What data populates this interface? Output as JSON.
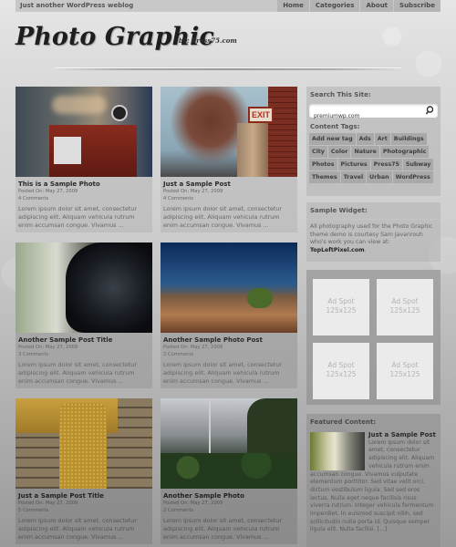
{
  "header": {
    "tagline": "Just another WordPress weblog",
    "site_title": "Photo Graphic",
    "byline": "by: Press75.com",
    "nav": [
      "Home",
      "Categories",
      "About",
      "Subscribe"
    ]
  },
  "posts": [
    {
      "title": "This is a Sample Photo",
      "date": "Posted On: May 27, 2009",
      "comments": "4 Comments",
      "excerpt": "Lorem ipsum dolor sit amet, consectetur adipiscing elit. Aliquam vehicula rutrum enim accumsan congue. Vivamus ...",
      "image": "red newspaper box with bokeh lights"
    },
    {
      "title": "Just a Sample Post",
      "date": "Posted On: May 27, 2009",
      "comments": "4 Comments",
      "excerpt": "Lorem ipsum dolor sit amet, consectetur adipiscing elit. Aliquam vehicula rutrum enim accumsan congue. Vivamus ...",
      "image": "exit sign on brick wall with tree"
    },
    {
      "title": "Another Sample Post Title",
      "date": "Posted On: May 27, 2009",
      "comments": "3 Comments",
      "excerpt": "Lorem ipsum dolor sit amet, consectetur adipiscing elit. Aliquam vehicula rutrum enim accumsan congue. Vivamus ...",
      "image": "gorilla portrait"
    },
    {
      "title": "Another Sample Photo Post",
      "date": "Posted On: May 27, 2009",
      "comments": "2 Comments",
      "excerpt": "Lorem ipsum dolor sit amet, consectetur adipiscing elit. Aliquam vehicula rutrum enim accumsan congue. Vivamus ...",
      "image": "canyon landscape at dusk"
    },
    {
      "title": "Just a Sample Post Title",
      "date": "Posted On: May 27, 2009",
      "comments": "5 Comments",
      "excerpt": "Lorem ipsum dolor sit amet, consectetur adipiscing elit. Aliquam vehicula rutrum enim accumsan congue. Vivamus ...",
      "image": "golden metal latch on wooden boards"
    },
    {
      "title": "Another Sample Photo",
      "date": "Posted On: May 27, 2009",
      "comments": "2 Comments",
      "excerpt": "Lorem ipsum dolor sit amet, consectetur adipiscing elit. Aliquam vehicula rutrum enim accumsan congue. Vivamus ...",
      "image": "steel building with greenery"
    }
  ],
  "sidebar": {
    "search": {
      "heading": "Search This Site:",
      "value": "premiumwp.com",
      "icon": "search-icon"
    },
    "tags_heading": "Content Tags:",
    "tags": [
      "Add new tag",
      "Ads",
      "Art",
      "Buildings",
      "City",
      "Color",
      "Nature",
      "Photographic",
      "Photos",
      "Pictures",
      "Press75",
      "Subway",
      "Themes",
      "Travel",
      "Urban",
      "WordPress"
    ],
    "widget": {
      "heading": "Sample Widget:",
      "text": "All photography used for the Photo Graphic theme demo is courtesy Sam Javanrouh who's work you can view at:",
      "link": "TopLeftPixel.com",
      "after": "."
    },
    "ads": [
      {
        "line1": "Ad Spot",
        "line2": "125x125"
      },
      {
        "line1": "Ad Spot",
        "line2": "125x125"
      },
      {
        "line1": "Ad Spot",
        "line2": "125x125"
      },
      {
        "line1": "Ad Spot",
        "line2": "125x125"
      }
    ],
    "featured": {
      "heading": "Featured Content:",
      "title": "Just a Sample Post",
      "text": "Lorem ipsum dolor sit amet, consectetur adipiscing elit. Aliquam vehicula rutrum enim accumsan congue. Vivamus vulputate elementum porttitor. Sed vitae velit orci, dictum vestibulum ligula. Sed sed eros lectus. Nulla eget neque facilisis risus viverra rutrum. Integer vehicula fermentum imperdiet. In euismod suscipit nibh, sed sollicitudin nulla porta id. Quisque semper ligula elit. Nulla facilisi. [...]",
      "image": "subway station with train"
    }
  }
}
